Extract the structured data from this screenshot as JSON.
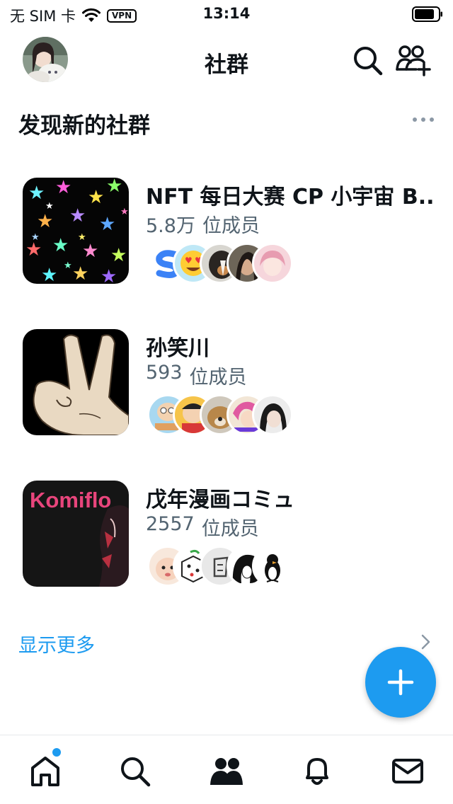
{
  "status_bar": {
    "carrier": "无 SIM 卡",
    "vpn": "VPN",
    "time": "13:14"
  },
  "header": {
    "title": "社群"
  },
  "section": {
    "title": "发现新的社群"
  },
  "communities": [
    {
      "name": "NFT 每日大赛 CP 小宇宙 B...",
      "members_count": "5.8万",
      "members_label": "位成员"
    },
    {
      "name": "孙笑川",
      "members_count": "593",
      "members_label": "位成员"
    },
    {
      "name": "戊年漫画コミュ",
      "members_count": "2557",
      "members_label": "位成员",
      "thumb_text": "Komiflo"
    }
  ],
  "show_more": "显示更多",
  "colors": {
    "accent": "#1d9bf0",
    "secondary_text": "#536471",
    "primary_text": "#0f1419"
  },
  "tab_bar": {
    "items": [
      "home-icon",
      "search-icon",
      "communities-icon",
      "notifications-icon",
      "messages-icon"
    ]
  }
}
